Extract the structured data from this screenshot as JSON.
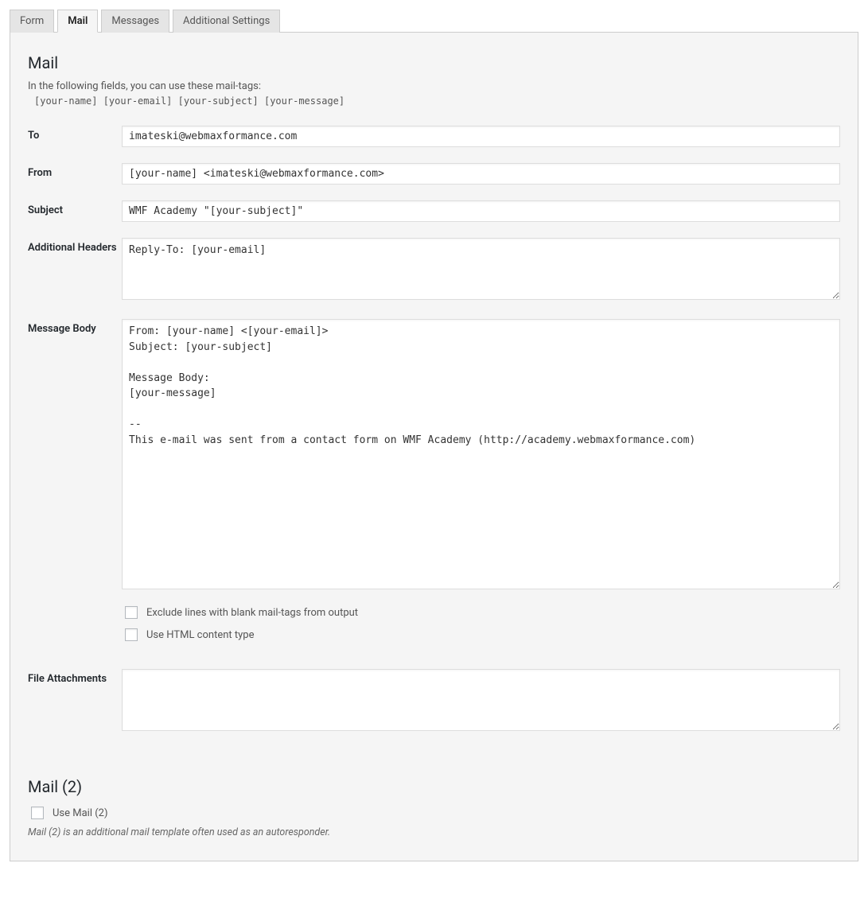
{
  "tabs": {
    "form": "Form",
    "mail": "Mail",
    "messages": "Messages",
    "additional": "Additional Settings"
  },
  "heading": "Mail",
  "intro": "In the following fields, you can use these mail-tags:",
  "mailtags": "[your-name] [your-email] [your-subject] [your-message]",
  "labels": {
    "to": "To",
    "from": "From",
    "subject": "Subject",
    "headers": "Additional Headers",
    "body": "Message Body",
    "attachments": "File Attachments"
  },
  "fields": {
    "to": "imateski@webmaxformance.com",
    "from": "[your-name] <imateski@webmaxformance.com>",
    "subject": "WMF Academy \"[your-subject]\"",
    "headers": "Reply-To: [your-email]",
    "body": "From: [your-name] <[your-email]>\nSubject: [your-subject]\n\nMessage Body:\n[your-message]\n\n--\nThis e-mail was sent from a contact form on WMF Academy (http://academy.webmaxformance.com)",
    "attachments": ""
  },
  "checkboxes": {
    "exclude": "Exclude lines with blank mail-tags from output",
    "html": "Use HTML content type"
  },
  "mail2": {
    "heading": "Mail (2)",
    "use": "Use Mail (2)",
    "note": "Mail (2) is an additional mail template often used as an autoresponder."
  }
}
